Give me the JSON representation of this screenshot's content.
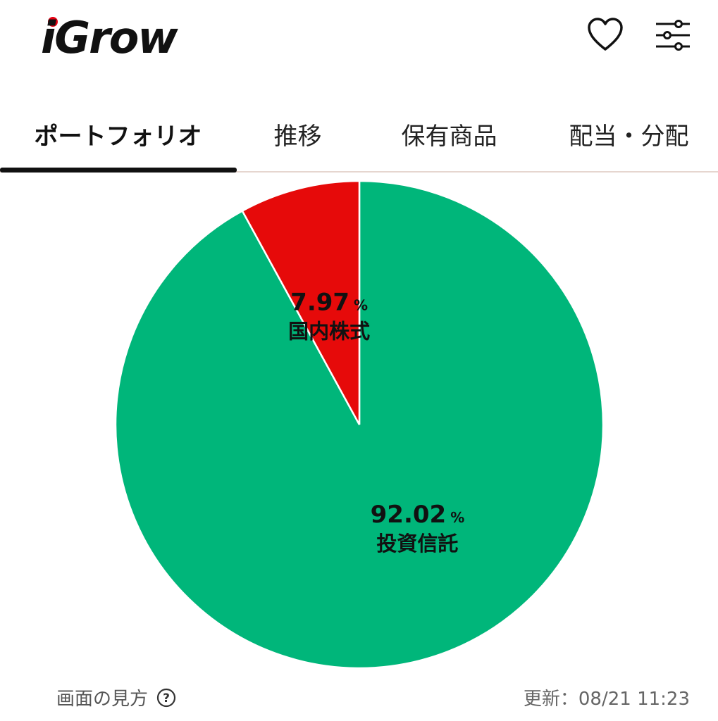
{
  "app": {
    "logo": "iGrow",
    "brand_color": "#e60012"
  },
  "header": {
    "favorite_icon": "heart-icon",
    "settings_icon": "sliders-icon"
  },
  "tabs": [
    {
      "label": "ポートフォリオ",
      "active": true
    },
    {
      "label": "推移",
      "active": false
    },
    {
      "label": "保有商品",
      "active": false
    },
    {
      "label": "配当・分配",
      "active": false
    }
  ],
  "chart_data": {
    "type": "pie",
    "slices": [
      {
        "label": "投資信託",
        "value": 92.02,
        "value_text": "92.02",
        "color": "#00b67a"
      },
      {
        "label": "国内株式",
        "value": 7.97,
        "value_text": "7.97",
        "color": "#e60a0a"
      }
    ],
    "unit": "%"
  },
  "footer": {
    "howto_label": "画面の見方",
    "updated_label": "更新：08/21 11:23"
  }
}
